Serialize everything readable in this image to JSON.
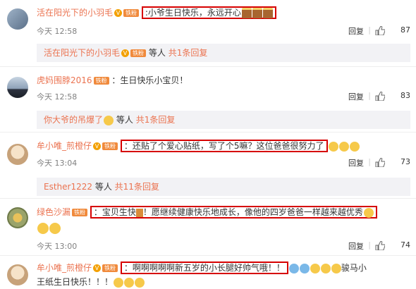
{
  "like_icon": "thumbs-up-icon",
  "comments": [
    {
      "user": "活在阳光下的小羽毛",
      "text": "小爷生日快乐，永远开心",
      "time": "今天 12:58",
      "reply": "回复",
      "likes": "87",
      "sub": {
        "name": "活在阳光下的小羽毛",
        "mid": "等人",
        "count": "共1条回复"
      }
    },
    {
      "user": "虎妈围脖2016",
      "text": "生日快乐小宝贝！",
      "time": "今天 12:58",
      "reply": "回复",
      "likes": "83",
      "sub": {
        "name": "你大爷的吊爆了",
        "mid": "等人",
        "count": "共1条回复"
      }
    },
    {
      "user": "牟小唯_煎橙仔",
      "text": "还贴了个爱心贴纸，写了个5嘛？这位爸爸很努力了",
      "time": "今天 13:04",
      "reply": "回复",
      "likes": "73",
      "sub": {
        "name": "Esther1222",
        "mid": "等人",
        "count": "共11条回复"
      }
    },
    {
      "user": "绿色沙漏",
      "text": "宝贝生快",
      "text2": "！愿继续健康快乐地成长，像他的四岁爸爸一样越来越优秀",
      "time": "今天 13:00",
      "reply": "回复",
      "likes": "74"
    },
    {
      "user": "牟小唯_煎橙仔",
      "text": "啊啊啊啊啊新五岁的小长腿好帅气哦！！",
      "text_tail": "骏马小",
      "text_line2": "王纸生日快乐！！！"
    }
  ],
  "badge_fan": "铁粉",
  "colors": {
    "username": "#eb7350",
    "highlight": "#d60000",
    "replybg": "#f2f2f5"
  }
}
